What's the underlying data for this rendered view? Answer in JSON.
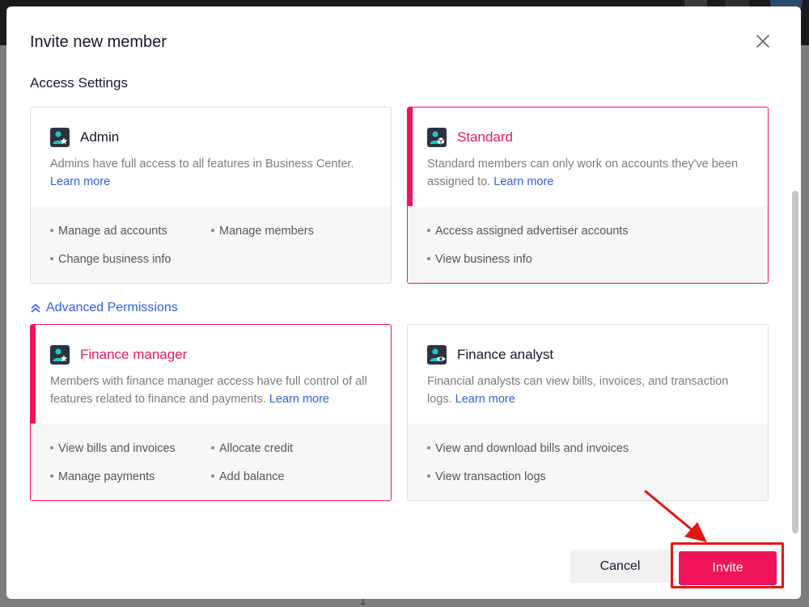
{
  "modal": {
    "title": "Invite new member",
    "section_title": "Access Settings",
    "advanced_toggle": "Advanced Permissions",
    "learn_more": "Learn more"
  },
  "roles": {
    "admin": {
      "title": "Admin",
      "description": "Admins have full access to all features in Business Center.",
      "permissions": [
        "Manage ad accounts",
        "Manage members",
        "Change business info"
      ]
    },
    "standard": {
      "title": "Standard",
      "description": "Standard members can only work on accounts they've been assigned to.",
      "permissions": [
        "Access assigned advertiser accounts",
        "View business info"
      ],
      "selected": true
    },
    "finance_manager": {
      "title": "Finance manager",
      "description": "Members with finance manager access have full control of all features related to finance and payments.",
      "permissions": [
        "View bills and invoices",
        "Allocate credit",
        "Manage payments",
        "Add balance"
      ],
      "selected": true
    },
    "finance_analyst": {
      "title": "Finance analyst",
      "description": "Financial analysts can view bills, invoices, and transaction logs.",
      "permissions": [
        "View and download bills and invoices",
        "View transaction logs"
      ]
    }
  },
  "footer": {
    "cancel_label": "Cancel",
    "invite_label": "Invite"
  },
  "background": {
    "count": "1"
  },
  "icons": {
    "close": "close-icon",
    "admin": "admin-star-user-icon",
    "standard": "standard-cube-user-icon",
    "finance_manager": "finance-manager-star-user-icon",
    "finance_analyst": "finance-analyst-eye-user-icon",
    "advanced": "chevron-double-up-icon"
  },
  "colors": {
    "accent": "#f0145a",
    "link": "#2f5de0",
    "icon_teal": "#21c4c6",
    "icon_dark": "#2b3340",
    "annotation": "#e3150f"
  }
}
